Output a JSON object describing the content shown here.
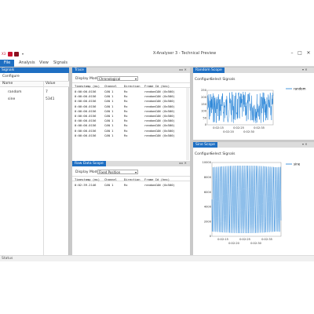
{
  "app": {
    "title": "X-Analyser 3 - Technical Preview",
    "window_controls": [
      "–",
      "□",
      "✕"
    ]
  },
  "menu": {
    "file": "File",
    "items": [
      "Analysis",
      "View",
      "Signals"
    ]
  },
  "signals_panel": {
    "title": "Signals",
    "configure": "Configure",
    "columns": [
      "Name",
      "Value"
    ],
    "rows": [
      {
        "name": "random",
        "value": "7"
      },
      {
        "name": "sine",
        "value": "5341"
      }
    ]
  },
  "trace_panel": {
    "tab": "Trace",
    "display_mode_label": "Display Mode",
    "display_mode_value": "Chronological",
    "columns": [
      "Timestamp (ms)",
      "Channel",
      "Direction",
      "Frame Id (hex)"
    ],
    "rows": [
      [
        "0:00:00.0156",
        "CAN 1",
        "Rx",
        "randomCAN (0x500)"
      ],
      [
        "0:00:00.0156",
        "CAN 1",
        "Rx",
        "randomCAN (0x500)"
      ],
      [
        "0:00:00.0156",
        "CAN 1",
        "Rx",
        "randomCAN (0x500)"
      ],
      [
        "0:00:00.0156",
        "CAN 1",
        "Rx",
        "randomCAN (0x500)"
      ],
      [
        "0:00:00.0156",
        "CAN 1",
        "Rx",
        "randomCAN (0x500)"
      ],
      [
        "0:00:00.0156",
        "CAN 1",
        "Rx",
        "randomCAN (0x500)"
      ],
      [
        "0:00:00.0156",
        "CAN 1",
        "Rx",
        "randomCAN (0x500)"
      ],
      [
        "0:00:00.0156",
        "CAN 1",
        "Rx",
        "randomCAN (0x500)"
      ],
      [
        "0:00:00.0156",
        "CAN 1",
        "Rx",
        "randomCAN (0x500)"
      ],
      [
        "0:00:00.0156",
        "CAN 1",
        "Rx",
        "randomCAN (0x500)"
      ]
    ]
  },
  "raw_data_panel": {
    "tab": "Raw Data Scope",
    "display_mode_label": "Display Mode",
    "display_mode_value": "Fixed Position",
    "columns": [
      "Timestamp (ms)",
      "Channel",
      "Direction",
      "Frame Id (hex)"
    ],
    "rows": [
      [
        "0:02:39.2146",
        "CAN 1",
        "Rx",
        "randomCAN (0x500)"
      ]
    ]
  },
  "random_scope": {
    "tab": "Random Scope",
    "toolbar": [
      "Configure",
      "Select Signals"
    ],
    "legend": "random",
    "y_ticks": [
      "250",
      "200",
      "150",
      "100",
      "50",
      "0"
    ],
    "x_ticks_top": [
      "0:02:15",
      "0:02:25",
      "0:02:35"
    ],
    "x_ticks_bottom": [
      "0:02:20",
      "0:02:30"
    ]
  },
  "sine_scope": {
    "tab": "Sine Scope",
    "toolbar": [
      "Configure",
      "Select Signals"
    ],
    "legend": "sine",
    "y_ticks": [
      "10000",
      "8000",
      "6000",
      "4000",
      "2000",
      "0"
    ],
    "x_ticks_top": [
      "0:02:15",
      "0:02:25",
      "0:02:35"
    ],
    "x_ticks_bottom": [
      "0:02:20",
      "0:02:30"
    ]
  },
  "status": {
    "text": "Status"
  },
  "colors": {
    "accent": "#1f6fc2",
    "plot_line": "#1f7fd6",
    "qa_red": "#c8102e",
    "qa_dark": "#8a1020"
  }
}
